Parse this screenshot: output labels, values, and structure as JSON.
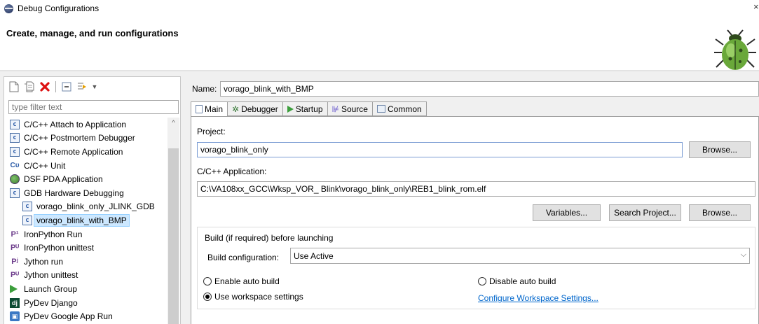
{
  "window": {
    "title": "Debug Configurations",
    "close": "×"
  },
  "header": {
    "title": "Create, manage, and run configurations"
  },
  "toolbar": {
    "new_icon": "new-config-icon",
    "duplicate_icon": "duplicate-icon",
    "delete_icon": "delete-icon",
    "collapse_icon": "collapse-all-icon",
    "filter_icon": "filter-icon",
    "dropdown_icon": "chevron-down-icon"
  },
  "filter": {
    "placeholder": "type filter text"
  },
  "tree": {
    "items": [
      {
        "label": "C/C++ Attach to Application",
        "icon": "c",
        "type": "c"
      },
      {
        "label": "C/C++ Postmortem Debugger",
        "icon": "c",
        "type": "c"
      },
      {
        "label": "C/C++ Remote Application",
        "icon": "c",
        "type": "c"
      },
      {
        "label": "C/C++ Unit",
        "icon": "Cᴜ",
        "type": "cu"
      },
      {
        "label": "DSF PDA Application",
        "icon": "",
        "type": "dsf"
      },
      {
        "label": "GDB Hardware Debugging",
        "icon": "c",
        "type": "c"
      },
      {
        "label": "vorago_blink_only_JLINK_GDB",
        "icon": "c",
        "type": "c",
        "child": true
      },
      {
        "label": "vorago_blink_with_BMP",
        "icon": "c",
        "type": "c",
        "child": true,
        "selected": true
      },
      {
        "label": "IronPython Run",
        "icon": "P¹",
        "type": "py"
      },
      {
        "label": "IronPython unittest",
        "icon": "Pᵁ",
        "type": "py"
      },
      {
        "label": "Jython run",
        "icon": "Pʲ",
        "type": "py"
      },
      {
        "label": "Jython unittest",
        "icon": "Pᵁ",
        "type": "py"
      },
      {
        "label": "Launch Group",
        "icon": "",
        "type": "launch"
      },
      {
        "label": "PyDev Django",
        "icon": "dj",
        "type": "dj"
      },
      {
        "label": "PyDev Google App Run",
        "icon": "▣",
        "type": "gae"
      }
    ]
  },
  "config": {
    "name_label": "Name:",
    "name_value": "vorago_blink_with_BMP",
    "tabs": [
      {
        "label": "Main",
        "active": true
      },
      {
        "label": "Debugger"
      },
      {
        "label": "Startup"
      },
      {
        "label": "Source"
      },
      {
        "label": "Common"
      }
    ],
    "project_label": "Project:",
    "project_value": "vorago_blink_only",
    "browse_label": "Browse...",
    "app_label": "C/C++ Application:",
    "app_value": "C:\\VA108xx_GCC\\Wksp_VOR_ Blink\\vorago_blink_only\\REB1_blink_rom.elf",
    "variables_label": "Variables...",
    "search_label": "Search Project...",
    "browse2_label": "Browse...",
    "build_group_label": "Build (if required) before launching",
    "build_config_label": "Build configuration:",
    "build_config_value": "Use Active",
    "enable_auto_build": "Enable auto build",
    "disable_auto_build": "Disable auto build",
    "use_workspace": "Use workspace settings",
    "configure_link": "Configure Workspace Settings..."
  }
}
